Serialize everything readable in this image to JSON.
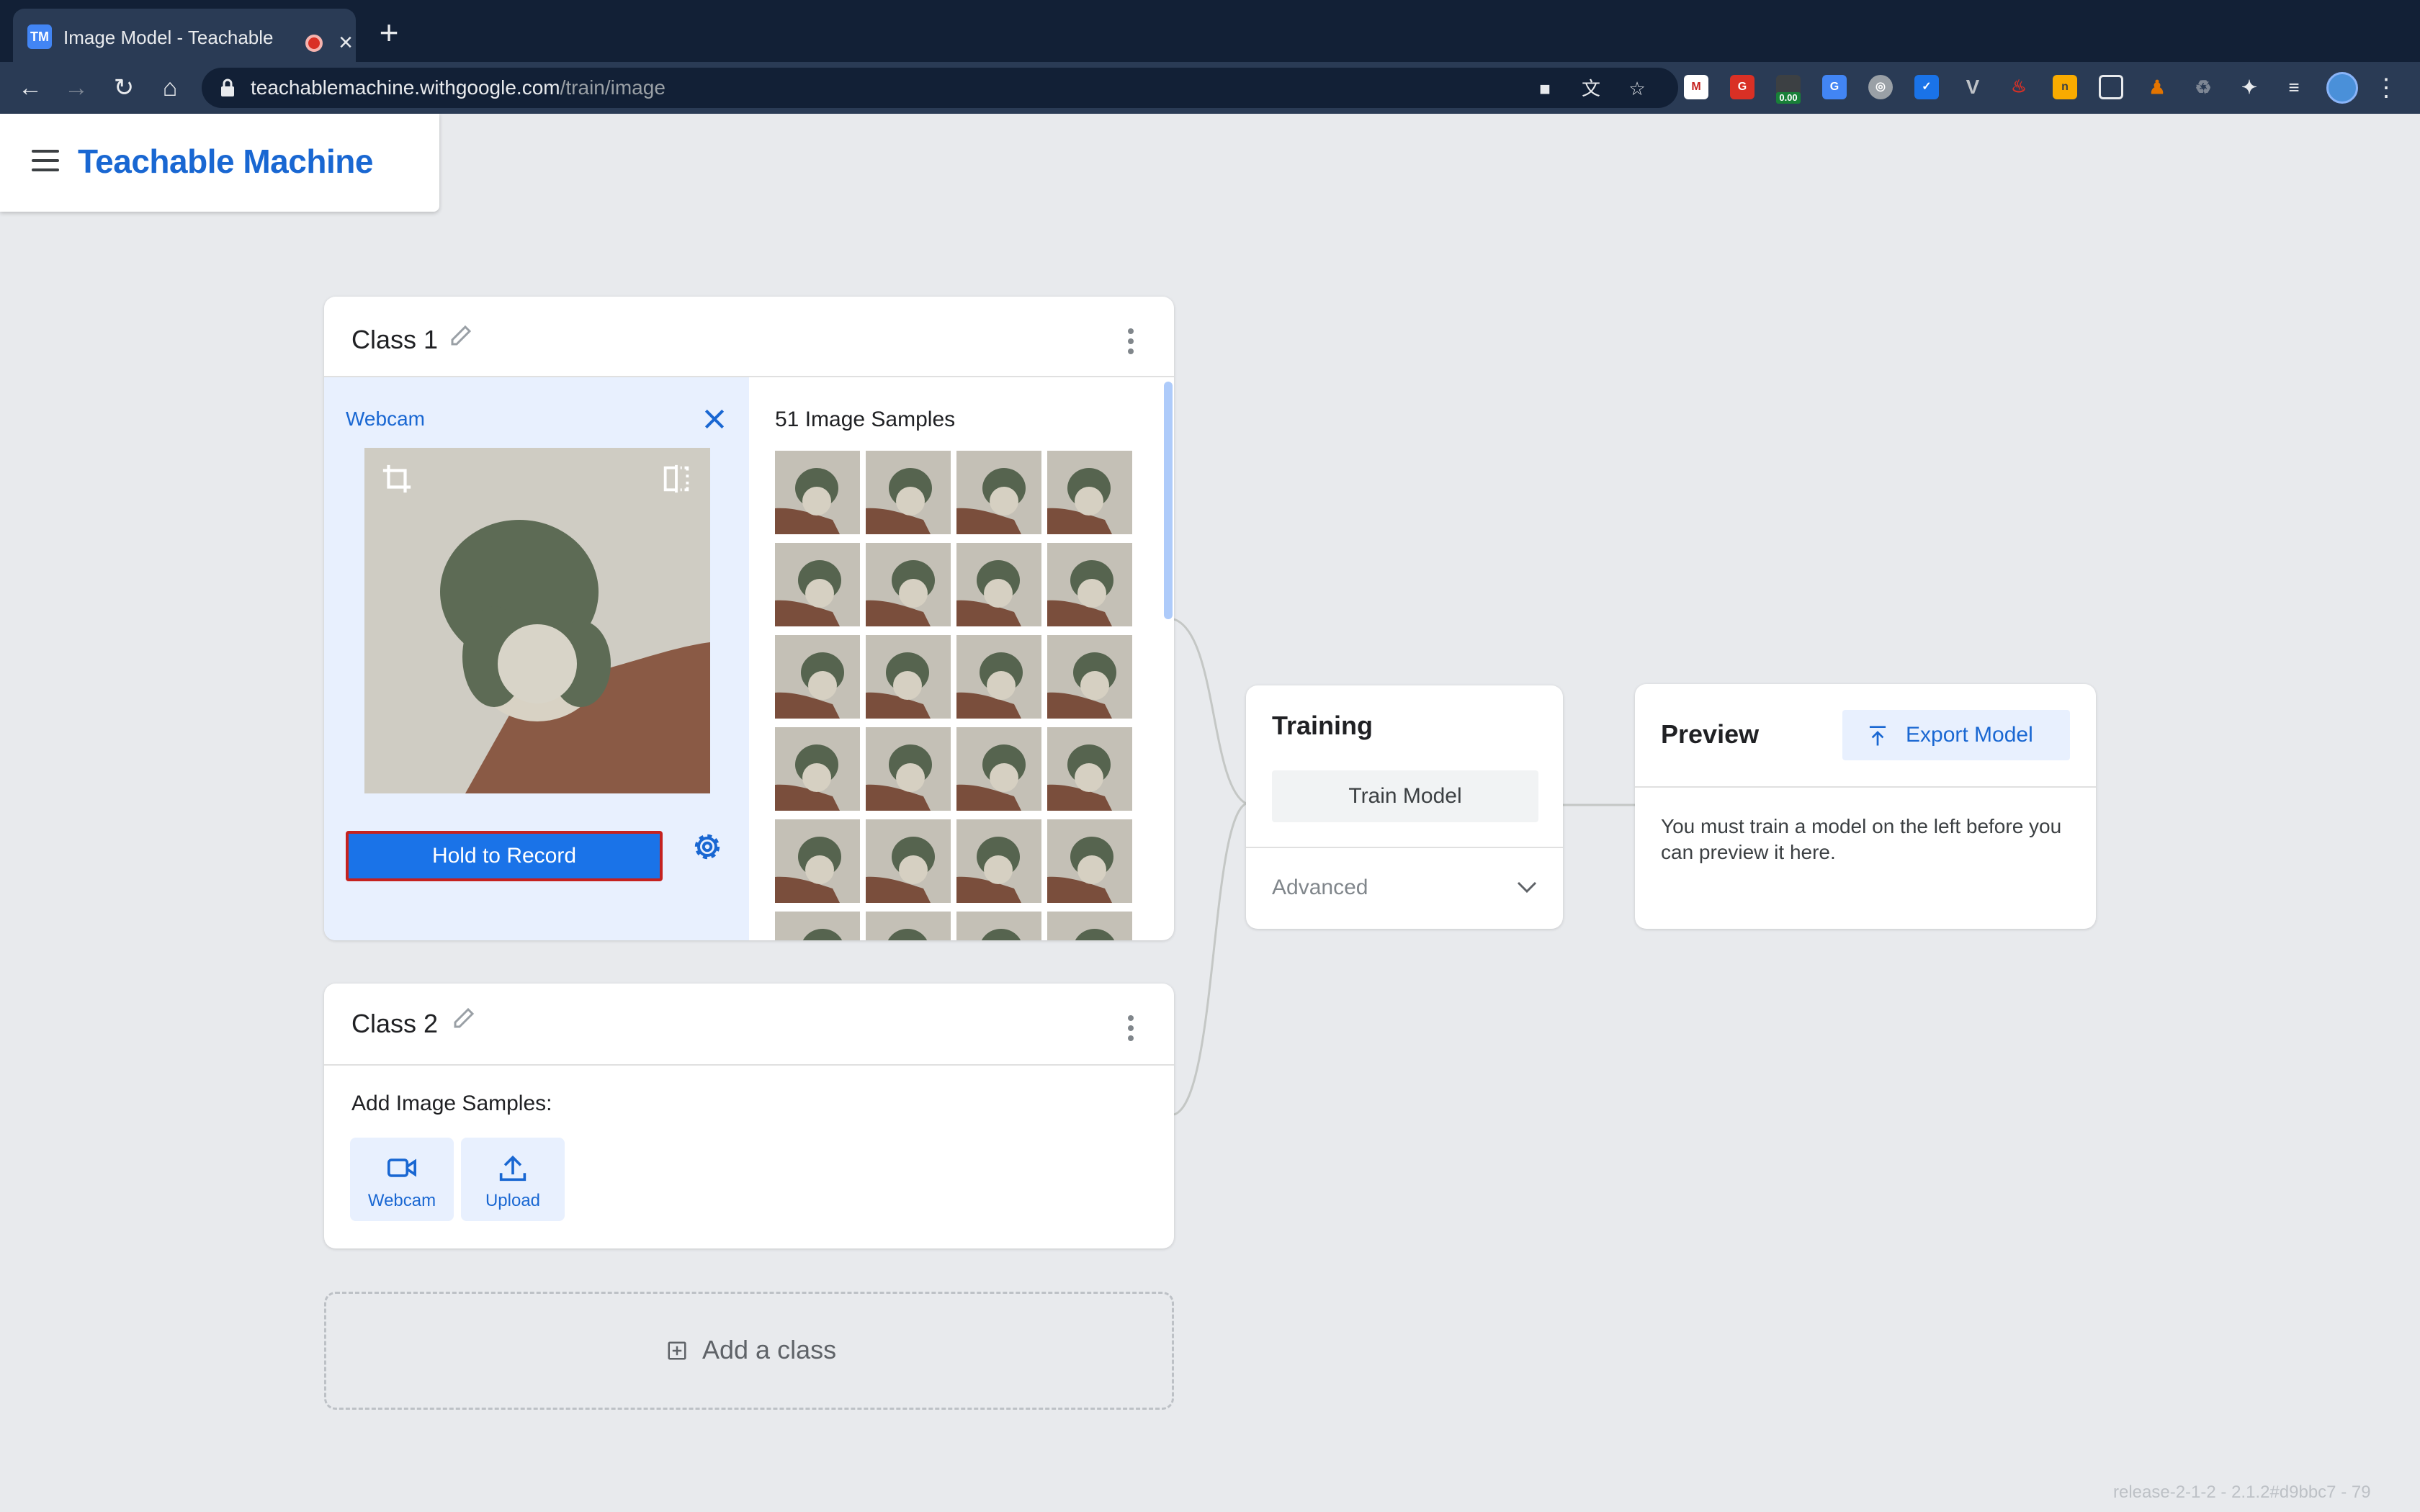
{
  "browser": {
    "tab_title": "Image Model - Teachable Machine",
    "favicon_text": "TM",
    "url_host": "teachablemachine.withgoogle.com",
    "url_path": "/train/image",
    "extension_badge": "0.00"
  },
  "app": {
    "brand": "Teachable Machine"
  },
  "class1": {
    "name": "Class 1",
    "source_label": "Webcam",
    "record_button": "Hold to Record",
    "samples_title": "51 Image Samples",
    "sample_count": 51
  },
  "class2": {
    "name": "Class 2",
    "add_samples_label": "Add Image Samples:",
    "webcam_label": "Webcam",
    "upload_label": "Upload"
  },
  "add_class": {
    "label": "Add a class"
  },
  "training": {
    "title": "Training",
    "train_button": "Train Model",
    "advanced_label": "Advanced"
  },
  "preview": {
    "title": "Preview",
    "export_button": "Export Model",
    "message": "You must train a model on the left before you can preview it here."
  },
  "footer": {
    "version": "release-2-1-2 - 2.1.2#d9bbc7 - 79"
  },
  "colors": {
    "accent": "#1a73e8",
    "brand": "#1967d2",
    "record_border": "#c5221f",
    "background": "#e8eaed"
  }
}
